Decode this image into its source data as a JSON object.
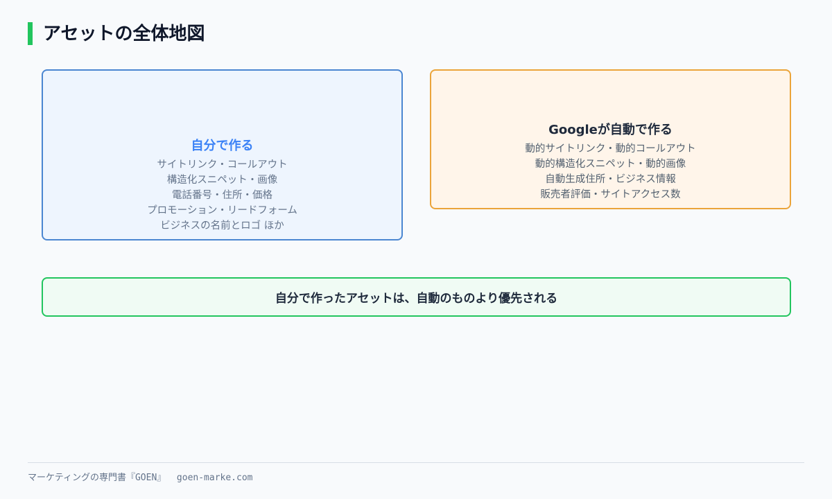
{
  "header": {
    "title": "アセットの全体地図"
  },
  "cards": {
    "self": {
      "title": "自分で作る",
      "lines": [
        "サイトリンク・コールアウト",
        "構造化スニペット・画像",
        "電話番号・住所・価格",
        "プロモーション・リードフォーム",
        "ビジネスの名前とロゴ ほか"
      ]
    },
    "google": {
      "title": "Googleが自動で作る",
      "lines": [
        "動的サイトリンク・動的コールアウト",
        "動的構造化スニペット・動的画像",
        "自動生成住所・ビジネス情報",
        "販売者評価・サイトアクセス数"
      ]
    }
  },
  "banner": {
    "text": "自分で作ったアセットは、自動のものより優先される"
  },
  "footer": {
    "text": "マーケティングの専門書『GOEN』  goen-marke.com"
  },
  "colors": {
    "accent_green": "#22c55e",
    "self_border": "#4a86d1",
    "self_title": "#3b82f6",
    "google_border": "#eba43a"
  }
}
